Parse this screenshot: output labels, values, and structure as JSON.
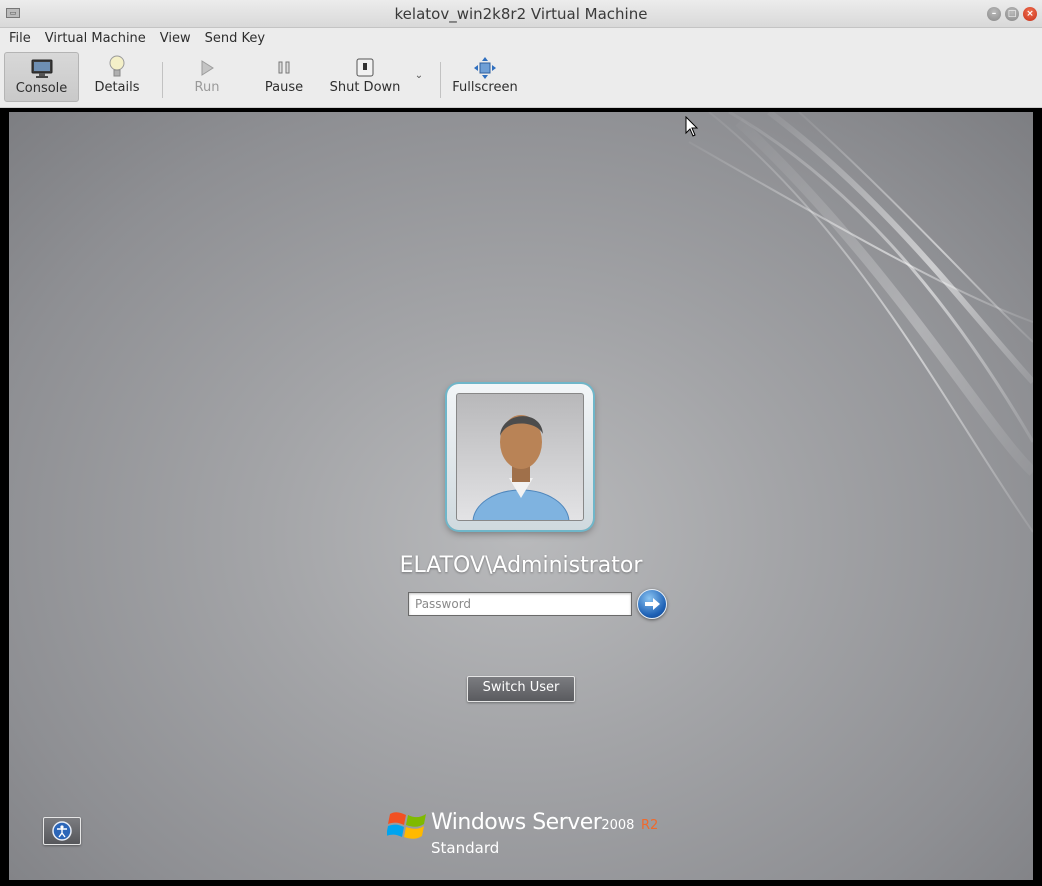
{
  "window": {
    "title": "kelatov_win2k8r2 Virtual Machine"
  },
  "menubar": {
    "items": [
      "File",
      "Virtual Machine",
      "View",
      "Send Key"
    ]
  },
  "toolbar": {
    "console_label": "Console",
    "details_label": "Details",
    "run_label": "Run",
    "pause_label": "Pause",
    "shutdown_label": "Shut Down",
    "fullscreen_label": "Fullscreen"
  },
  "login": {
    "username": "ELATOV\\Administrator",
    "password_placeholder": "Password",
    "switch_user_label": "Switch User"
  },
  "branding": {
    "product": "Windows Server",
    "version": "2008",
    "release": "R2",
    "edition": "Standard"
  },
  "colors": {
    "r2_accent": "#f06a2c",
    "go_button": "#1f62b6",
    "tile_glow": "#6fb6c9"
  }
}
